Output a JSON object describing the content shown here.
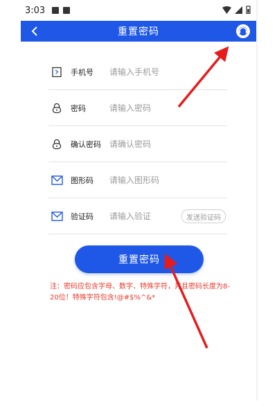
{
  "status_bar": {
    "time": "3:03"
  },
  "app_bar": {
    "title": "重置密码"
  },
  "form": {
    "rows": [
      {
        "label": "手机号",
        "placeholder": "请输入手机号",
        "icon": "phone-icon"
      },
      {
        "label": "密码",
        "placeholder": "请输入密码",
        "icon": "lock-icon"
      },
      {
        "label": "确认密码",
        "placeholder": "请确认密码",
        "icon": "lock-icon"
      },
      {
        "label": "图形码",
        "placeholder": "请输入图形码",
        "icon": "envelope-icon"
      },
      {
        "label": "验证码",
        "placeholder": "请输入验证",
        "icon": "envelope-icon"
      }
    ],
    "send_code_label": "发送验证码"
  },
  "submit_label": "重置密码",
  "note": "注：密码应包含字母、数字、特殊字符，并且密码长度为8-20位！特殊字符包含!@#$%^&*",
  "colors": {
    "primary": "#1f57e7",
    "note": "#e8392b",
    "annotation_arrow": "#e51c1c"
  }
}
